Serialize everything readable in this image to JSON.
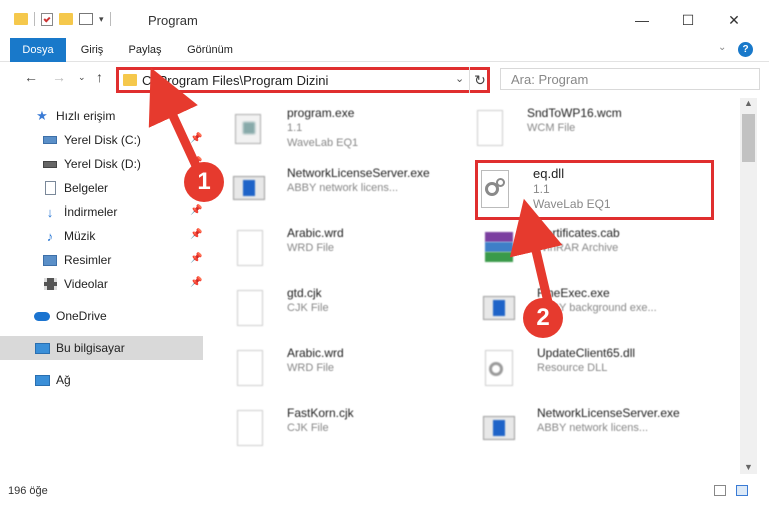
{
  "window": {
    "title": "Program"
  },
  "ribbon": {
    "tabs": [
      "Dosya",
      "Giriş",
      "Paylaş",
      "Görünüm"
    ]
  },
  "address": {
    "path": "C:\\Program Files\\Program Dizini"
  },
  "search": {
    "placeholder": "Ara: Program"
  },
  "sidebar": {
    "items": [
      {
        "label": "Hızlı erişim",
        "icon": "star-icon",
        "color": "#3a7bd5",
        "pinned": false
      },
      {
        "label": "Yerel Disk (C:)",
        "icon": "drive-icon",
        "color": "#5a8fc8",
        "pinned": true
      },
      {
        "label": "Yerel Disk (D:)",
        "icon": "drive-icon",
        "color": "#666666",
        "pinned": true
      },
      {
        "label": "Belgeler",
        "icon": "documents-icon",
        "color": "#7a8899",
        "pinned": true
      },
      {
        "label": "İndirmeler",
        "icon": "download-icon",
        "color": "#2b78d4",
        "pinned": true
      },
      {
        "label": "Müzik",
        "icon": "music-icon",
        "color": "#2b78d4",
        "pinned": true
      },
      {
        "label": "Resimler",
        "icon": "pictures-icon",
        "color": "#5a8fc8",
        "pinned": true
      },
      {
        "label": "Videolar",
        "icon": "video-icon",
        "color": "#555555",
        "pinned": true
      },
      {
        "label": "OneDrive",
        "icon": "cloud-icon",
        "color": "#1b74d0",
        "pinned": false
      },
      {
        "label": "Bu bilgisayar",
        "icon": "computer-icon",
        "color": "#3a8fd8",
        "pinned": false
      },
      {
        "label": "Ağ",
        "icon": "network-icon",
        "color": "#3a8fd8",
        "pinned": false
      }
    ]
  },
  "files": [
    {
      "name": "program.exe",
      "line2": "1.1",
      "line3": "WaveLab EQ1",
      "icon": "exe-icon"
    },
    {
      "name": "SndToWP16.wcm",
      "line2": "WCM File",
      "line3": "",
      "icon": "file-icon"
    },
    {
      "name": "NetworkLicenseServer.exe",
      "line2": "ABBY network licens...",
      "line3": "",
      "icon": "app-icon"
    },
    {
      "name": "eq.dll",
      "line2": "1.1",
      "line3": "WaveLab EQ1",
      "icon": "dll-gear-icon"
    },
    {
      "name": "Arabic.wrd",
      "line2": "WRD File",
      "line3": "",
      "icon": "file-icon"
    },
    {
      "name": "Certificates.cab",
      "line2": "WinRAR Archive",
      "line3": "",
      "icon": "archive-icon"
    },
    {
      "name": "gtd.cjk",
      "line2": "CJK File",
      "line3": "",
      "icon": "file-icon"
    },
    {
      "name": "FineExec.exe",
      "line2": "ABBY background exe...",
      "line3": "",
      "icon": "app-icon"
    },
    {
      "name": "Arabic.wrd",
      "line2": "WRD File",
      "line3": "",
      "icon": "file-icon"
    },
    {
      "name": "UpdateClient65.dll",
      "line2": "Resource DLL",
      "line3": "",
      "icon": "dll-gear-icon"
    },
    {
      "name": "FastKorn.cjk",
      "line2": "CJK File",
      "line3": "",
      "icon": "file-icon"
    },
    {
      "name": "NetworkLicenseServer.exe",
      "line2": "ABBY network licens...",
      "line3": "",
      "icon": "app-icon"
    }
  ],
  "status": {
    "count": "196 öğe"
  },
  "annotations": [
    "1",
    "2"
  ],
  "colors": {
    "accent": "#1979ca",
    "highlight": "#e02f2f",
    "badge": "#e63a2e"
  }
}
